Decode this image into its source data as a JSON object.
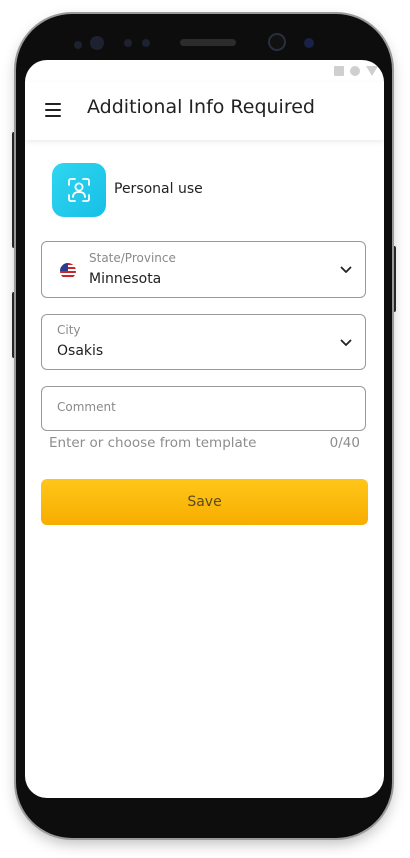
{
  "header": {
    "title": "Additional Info Required",
    "menu_icon": "hamburger-menu-icon"
  },
  "category": {
    "label": "Personal use",
    "icon": "face-scan-icon",
    "icon_color": "#22cbee"
  },
  "state_field": {
    "label": "State/Province",
    "value": "Minnesota",
    "flag_icon": "us-flag-icon"
  },
  "city_field": {
    "label": "City",
    "value": "Osakis"
  },
  "comment_field": {
    "placeholder": "Comment",
    "value": "",
    "helper": "Enter or choose from template",
    "counter": "0/40"
  },
  "actions": {
    "save_label": "Save",
    "save_color": "#fbb800"
  }
}
